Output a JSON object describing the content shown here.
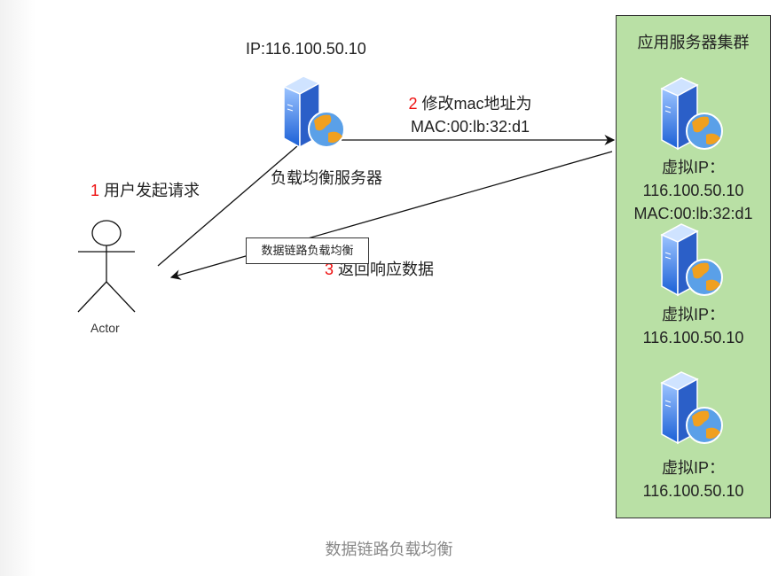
{
  "lb": {
    "ip": "IP:116.100.50.10",
    "name": "负载均衡服务器"
  },
  "step1": {
    "num": "1",
    "text": " 用户发起请求"
  },
  "step2": {
    "num": "2",
    "text": " 修改mac地址为",
    "mac": "MAC:00:lb:32:d1"
  },
  "step3": {
    "num": "3",
    "text": " 返回响应数据"
  },
  "edge_label": "数据链路负载均衡",
  "actor": {
    "label": "Actor"
  },
  "cluster": {
    "title": "应用服务器集群",
    "servers": [
      {
        "line1": "虚拟IP：",
        "line2": "116.100.50.10",
        "line3": "MAC:00:lb:32:d1"
      },
      {
        "line1": "虚拟IP：",
        "line2": "116.100.50.10"
      },
      {
        "line1": "虚拟IP：",
        "line2": "116.100.50.10"
      }
    ]
  },
  "caption": "数据链路负载均衡",
  "colors": {
    "cluster_bg": "#b9e0a5",
    "step_number": "#ee1111"
  }
}
